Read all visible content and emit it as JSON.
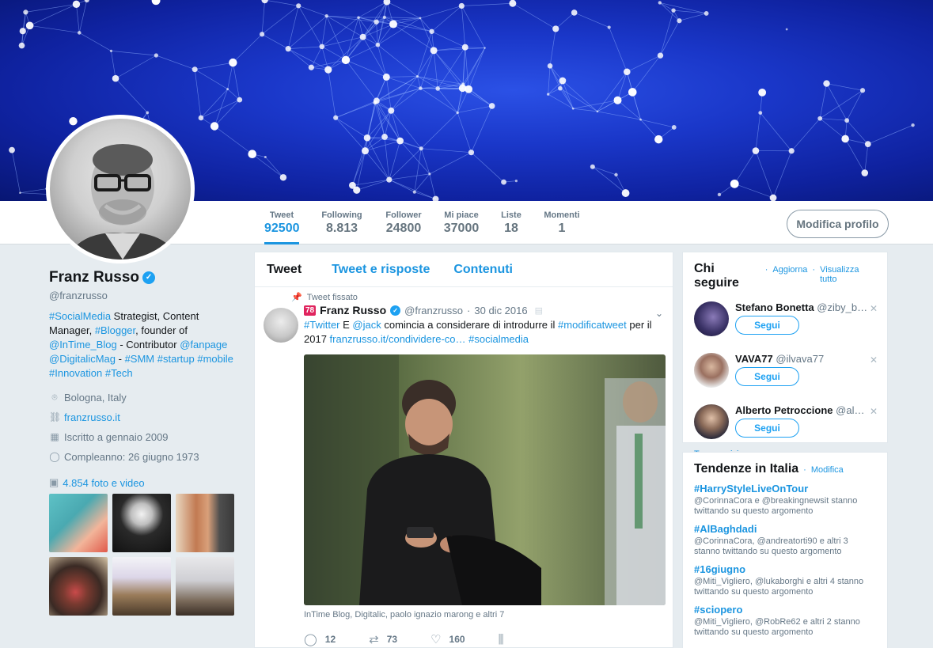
{
  "nav": {
    "stats": [
      {
        "label": "Tweet",
        "value": "92500"
      },
      {
        "label": "Following",
        "value": "8.813"
      },
      {
        "label": "Follower",
        "value": "24800"
      },
      {
        "label": "Mi piace",
        "value": "37000"
      },
      {
        "label": "Liste",
        "value": "18"
      },
      {
        "label": "Momenti",
        "value": "1"
      }
    ],
    "edit_profile": "Modifica profilo"
  },
  "profile": {
    "name": "Franz Russo",
    "handle": "@franzrusso",
    "bio": [
      {
        "t": "#SocialMedia",
        "link": true
      },
      {
        "t": " Strategist, Content Manager, ",
        "link": false
      },
      {
        "t": "#Blogger",
        "link": true
      },
      {
        "t": ", founder of ",
        "link": false
      },
      {
        "t": "@InTime_Blog",
        "link": true
      },
      {
        "t": " - Contributor ",
        "link": false
      },
      {
        "t": "@fanpage",
        "link": true
      },
      {
        "t": " ",
        "link": false
      },
      {
        "t": "@DigitalicMag",
        "link": true
      },
      {
        "t": " - ",
        "link": false
      },
      {
        "t": "#SMM",
        "link": true
      },
      {
        "t": " ",
        "link": false
      },
      {
        "t": "#startup",
        "link": true
      },
      {
        "t": " ",
        "link": false
      },
      {
        "t": "#mobile",
        "link": true
      },
      {
        "t": " ",
        "link": false
      },
      {
        "t": "#Innovation",
        "link": true
      },
      {
        "t": " ",
        "link": false
      },
      {
        "t": "#Tech",
        "link": true
      }
    ],
    "location": "Bologna, Italy",
    "website": "franzrusso.it",
    "joined": "Iscritto a gennaio 2009",
    "birthday": "Compleanno: 26 giugno 1973",
    "photos": "4.854 foto e video"
  },
  "timeline": {
    "tabs": [
      "Tweet",
      "Tweet e risposte",
      "Contenuti"
    ],
    "pinned_label": "Tweet fissato",
    "tweet": {
      "badge": "78",
      "name": "Franz Russo",
      "handle": "@franzrusso",
      "date": "30 dic 2016",
      "text": [
        {
          "t": "#Twitter",
          "link": true
        },
        {
          "t": " E ",
          "link": false
        },
        {
          "t": "@jack",
          "link": true
        },
        {
          "t": " comincia a considerare di introdurre il ",
          "link": false
        },
        {
          "t": "#modificatweet",
          "link": true
        },
        {
          "t": " per il 2017  ",
          "link": false
        },
        {
          "t": "franzrusso.it/condividere-co…",
          "link": true
        },
        {
          "t": " ",
          "link": false
        },
        {
          "t": "#socialmedia",
          "link": true
        }
      ],
      "tagged": "InTime Blog, Digitalic, paolo ignazio marong e altri 7",
      "replies": "12",
      "retweets": "73",
      "likes": "160"
    }
  },
  "who_to_follow": {
    "title": "Chi seguire",
    "refresh": "Aggiorna",
    "view_all": "Visualizza tutto",
    "follow_label": "Segui",
    "suggestions": [
      {
        "name": "Stefano Bonetta",
        "handle": "@ziby_b…"
      },
      {
        "name": "VAVA77",
        "handle": "@ilvava77"
      },
      {
        "name": "Alberto Petroccione",
        "handle": "@al…"
      }
    ],
    "find_friends": "Trova amici"
  },
  "trends": {
    "title": "Tendenze in Italia",
    "edit": "Modifica",
    "items": [
      {
        "tag": "#HarryStyleLiveOnTour",
        "context": "@CorinnaCora e @breakingnewsit stanno twittando su questo argomento"
      },
      {
        "tag": "#AlBaghdadi",
        "context": "@CorinnaCora, @andreatorti90 e altri 3 stanno twittando su questo argomento"
      },
      {
        "tag": "#16giugno",
        "context": "@Miti_Vigliero, @lukaborghi e altri 4 stanno twittando su questo argomento"
      },
      {
        "tag": "#sciopero",
        "context": "@Miti_Vigliero, @RobRe62 e altri 2 stanno twittando su questo argomento"
      }
    ]
  },
  "colors": {
    "accent": "#1b95e0",
    "banner": "#1a37c9",
    "verified": "#1da1f2"
  }
}
